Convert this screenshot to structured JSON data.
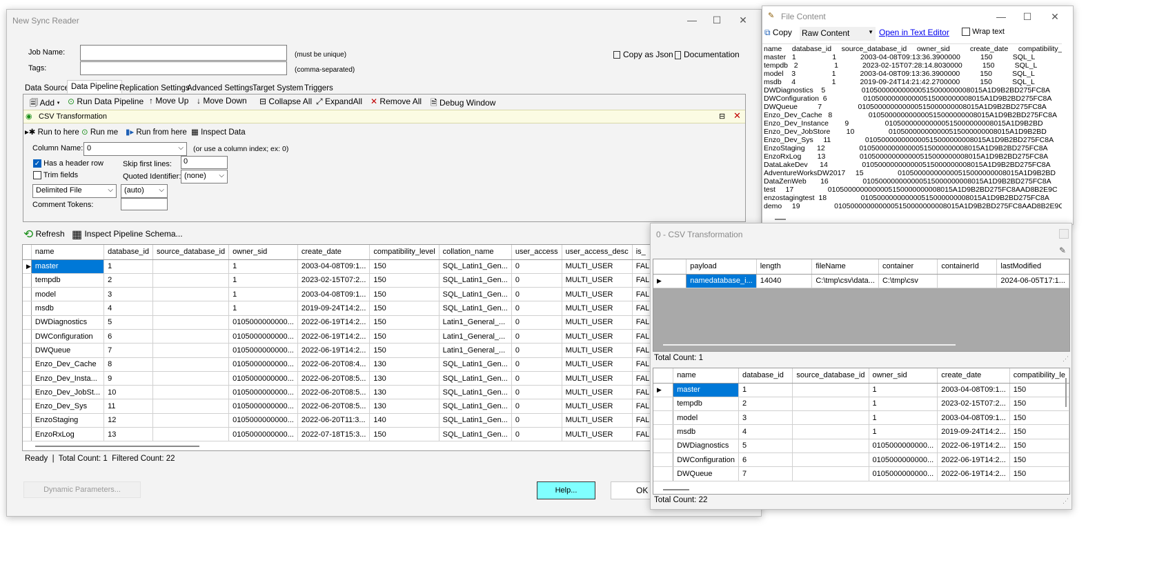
{
  "main": {
    "title": "New Sync Reader",
    "job_name_label": "Job Name:",
    "job_name_hint": "(must be unique)",
    "tags_label": "Tags:",
    "tags_hint": "(comma-separated)",
    "copy_json": "Copy as Json",
    "documentation": "Documentation",
    "tabs": [
      "Data Source",
      "Data Pipeline",
      "Replication Settings",
      "Advanced Settings",
      "Target System",
      "Triggers"
    ],
    "toolbar": {
      "add": "Add",
      "run_pipeline": "Run Data Pipeline",
      "move_up": "Move Up",
      "move_down": "Move Down",
      "collapse_all": "Collapse All",
      "expand_all": "ExpandAll",
      "remove_all": "Remove All",
      "debug_window": "Debug Window"
    },
    "step": {
      "title": "CSV Transformation",
      "run_to_here": "Run to here",
      "run_me": "Run me",
      "run_from_here": "Run from here",
      "inspect_data": "Inspect Data",
      "column_name_label": "Column Name:",
      "column_name_value": "0",
      "column_hint": "(or use a column index; ex: 0)",
      "has_header": "Has a header row",
      "trim_fields": "Trim fields",
      "skip_first_label": "Skip first lines:",
      "skip_first_value": "0",
      "quoted_label": "Quoted Identifier:",
      "quoted_value": "(none)",
      "file_type": "Delimited File",
      "delimiter": "(auto)",
      "comment_tokens": "Comment Tokens:"
    },
    "refresh": "Refresh",
    "inspect_schema": "Inspect Pipeline Schema...",
    "grid": {
      "columns": [
        "name",
        "database_id",
        "source_database_id",
        "owner_sid",
        "create_date",
        "compatibility_level",
        "collation_name",
        "user_access",
        "user_access_desc",
        "is_"
      ],
      "rows": [
        [
          "master",
          "1",
          "",
          "1",
          "2003-04-08T09:1...",
          "150",
          "SQL_Latin1_Gen...",
          "0",
          "MULTI_USER",
          "FAL"
        ],
        [
          "tempdb",
          "2",
          "",
          "1",
          "2023-02-15T07:2...",
          "150",
          "SQL_Latin1_Gen...",
          "0",
          "MULTI_USER",
          "FAL"
        ],
        [
          "model",
          "3",
          "",
          "1",
          "2003-04-08T09:1...",
          "150",
          "SQL_Latin1_Gen...",
          "0",
          "MULTI_USER",
          "FAL"
        ],
        [
          "msdb",
          "4",
          "",
          "1",
          "2019-09-24T14:2...",
          "150",
          "SQL_Latin1_Gen...",
          "0",
          "MULTI_USER",
          "FAL"
        ],
        [
          "DWDiagnostics",
          "5",
          "",
          "0105000000000...",
          "2022-06-19T14:2...",
          "150",
          "Latin1_General_...",
          "0",
          "MULTI_USER",
          "FAL"
        ],
        [
          "DWConfiguration",
          "6",
          "",
          "0105000000000...",
          "2022-06-19T14:2...",
          "150",
          "Latin1_General_...",
          "0",
          "MULTI_USER",
          "FAL"
        ],
        [
          "DWQueue",
          "7",
          "",
          "0105000000000...",
          "2022-06-19T14:2...",
          "150",
          "Latin1_General_...",
          "0",
          "MULTI_USER",
          "FAL"
        ],
        [
          "Enzo_Dev_Cache",
          "8",
          "",
          "0105000000000...",
          "2022-06-20T08:4...",
          "130",
          "SQL_Latin1_Gen...",
          "0",
          "MULTI_USER",
          "FAL"
        ],
        [
          "Enzo_Dev_Insta...",
          "9",
          "",
          "0105000000000...",
          "2022-06-20T08:5...",
          "130",
          "SQL_Latin1_Gen...",
          "0",
          "MULTI_USER",
          "FAL"
        ],
        [
          "Enzo_Dev_JobSt...",
          "10",
          "",
          "0105000000000...",
          "2022-06-20T08:5...",
          "130",
          "SQL_Latin1_Gen...",
          "0",
          "MULTI_USER",
          "FAL"
        ],
        [
          "Enzo_Dev_Sys",
          "11",
          "",
          "0105000000000...",
          "2022-06-20T08:5...",
          "130",
          "SQL_Latin1_Gen...",
          "0",
          "MULTI_USER",
          "FAL"
        ],
        [
          "EnzoStaging",
          "12",
          "",
          "0105000000000...",
          "2022-06-20T11:3...",
          "140",
          "SQL_Latin1_Gen...",
          "0",
          "MULTI_USER",
          "FAL"
        ],
        [
          "EnzoRxLog",
          "13",
          "",
          "0105000000000...",
          "2022-07-18T15:3...",
          "150",
          "SQL_Latin1_Gen...",
          "0",
          "MULTI_USER",
          "FAL"
        ]
      ]
    },
    "status": "Ready  |  Total Count: 1  Filtered Count: 22",
    "dynamic_params": "Dynamic Parameters...",
    "help": "Help...",
    "ok": "OK"
  },
  "file_content": {
    "title": "File Content",
    "copy": "Copy",
    "mode": "Raw Content",
    "open_editor": "Open in Text Editor",
    "wrap_text": "Wrap text",
    "text": "name     database_id     source_database_id     owner_sid          create_date     compatibility_level\nmaster   1                  1            2003-04-08T09:13:36.3900000          150          SQL_L\ntempdb   2                  1            2023-02-15T07:28:14.8030000          150          SQL_L\nmodel    3                  1            2003-04-08T09:13:36.3900000          150          SQL_L\nmsdb     4                  1            2019-09-24T14:21:42.2700000          150          SQL_L\nDWDiagnostics    5                  010500000000000515000000008015A1D9B2BD275FC8A\nDWConfiguration  6                  010500000000000515000000008015A1D9B2BD275FC8A\nDWQueue          7                  010500000000000515000000008015A1D9B2BD275FC8A\nEnzo_Dev_Cache   8                  010500000000000515000000008015A1D9B2BD275FC8A\nEnzo_Dev_Instance        9                  010500000000000515000000008015A1D9B2BD\nEnzo_Dev_JobStore        10                 010500000000000515000000008015A1D9B2BD\nEnzo_Dev_Sys     11                 010500000000000515000000008015A1D9B2BD275FC8A\nEnzoStaging      12                 010500000000000515000000008015A1D9B2BD275FC8A\nEnzoRxLog        13                 010500000000000515000000008015A1D9B2BD275FC8A\nDataLakeDev      14                 010500000000000515000000008015A1D9B2BD275FC8A\nAdventureWorksDW2017     15                 010500000000000515000000008015A1D9B2BD\nDataZenWeb       16                 010500000000000515000000008015A1D9B2BD275FC8A\ntest     17                 0105000000000005150000000008015A1D9B2BD275FC8AAD8B2E9C\nenzostagingtest  18                 010500000000000515000000008015A1D9B2BD275FC8A\ndemo     19                 0105000000000005150000000008015A1D9B2BD275FC8AAD8B2E9C"
  },
  "csv_window": {
    "title": "0 - CSV Transformation",
    "top_grid": {
      "columns": [
        "payload",
        "length",
        "fileName",
        "container",
        "containerId",
        "lastModified"
      ],
      "rows": [
        [
          "namedatabase_i...",
          "14040",
          "C:\\tmp\\csv\\data...",
          "C:\\tmp\\csv",
          "",
          "2024-06-05T17:1..."
        ]
      ]
    },
    "top_total": "Total Count: 1",
    "bottom_grid": {
      "columns": [
        "name",
        "database_id",
        "source_database_id",
        "owner_sid",
        "create_date",
        "compatibility_le"
      ],
      "rows": [
        [
          "master",
          "1",
          "",
          "1",
          "2003-04-08T09:1...",
          "150"
        ],
        [
          "tempdb",
          "2",
          "",
          "1",
          "2023-02-15T07:2...",
          "150"
        ],
        [
          "model",
          "3",
          "",
          "1",
          "2003-04-08T09:1...",
          "150"
        ],
        [
          "msdb",
          "4",
          "",
          "1",
          "2019-09-24T14:2...",
          "150"
        ],
        [
          "DWDiagnostics",
          "5",
          "",
          "0105000000000...",
          "2022-06-19T14:2...",
          "150"
        ],
        [
          "DWConfiguration",
          "6",
          "",
          "0105000000000...",
          "2022-06-19T14:2...",
          "150"
        ],
        [
          "DWQueue",
          "7",
          "",
          "0105000000000...",
          "2022-06-19T14:2...",
          "150"
        ]
      ]
    },
    "bottom_total": "Total Count: 22"
  },
  "colors": {
    "selection": "#0078d7",
    "step_header": "#fbfbe3",
    "help_button": "#80ffff",
    "link": "#0000ee",
    "remove_red": "#c00000",
    "run_green": "#1a8f1a"
  }
}
